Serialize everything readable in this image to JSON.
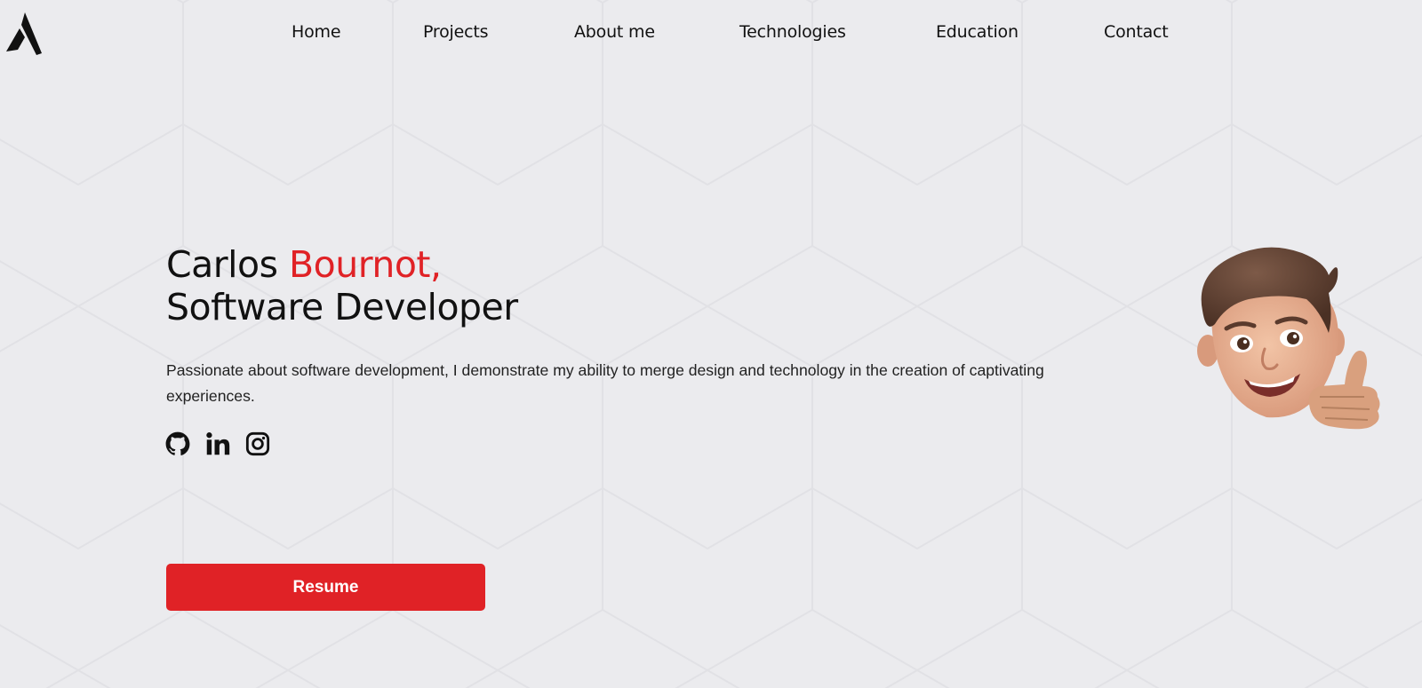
{
  "nav": {
    "items": [
      {
        "label": "Home"
      },
      {
        "label": "Projects"
      },
      {
        "label": "About me"
      },
      {
        "label": "Technologies"
      },
      {
        "label": "Education"
      },
      {
        "label": "Contact"
      }
    ]
  },
  "hero": {
    "first_name": "Carlos",
    "last_name": "Bournot,",
    "role": "Software Developer",
    "description": "Passionate about software development, I demonstrate my ability to merge design and technology in the creation of captivating experiences."
  },
  "socials": {
    "icons": [
      "github-icon",
      "linkedin-icon",
      "instagram-icon"
    ]
  },
  "resume": {
    "label": "Resume"
  },
  "colors": {
    "accent": "#e02226",
    "background": "#ebebee",
    "text": "#111111"
  }
}
